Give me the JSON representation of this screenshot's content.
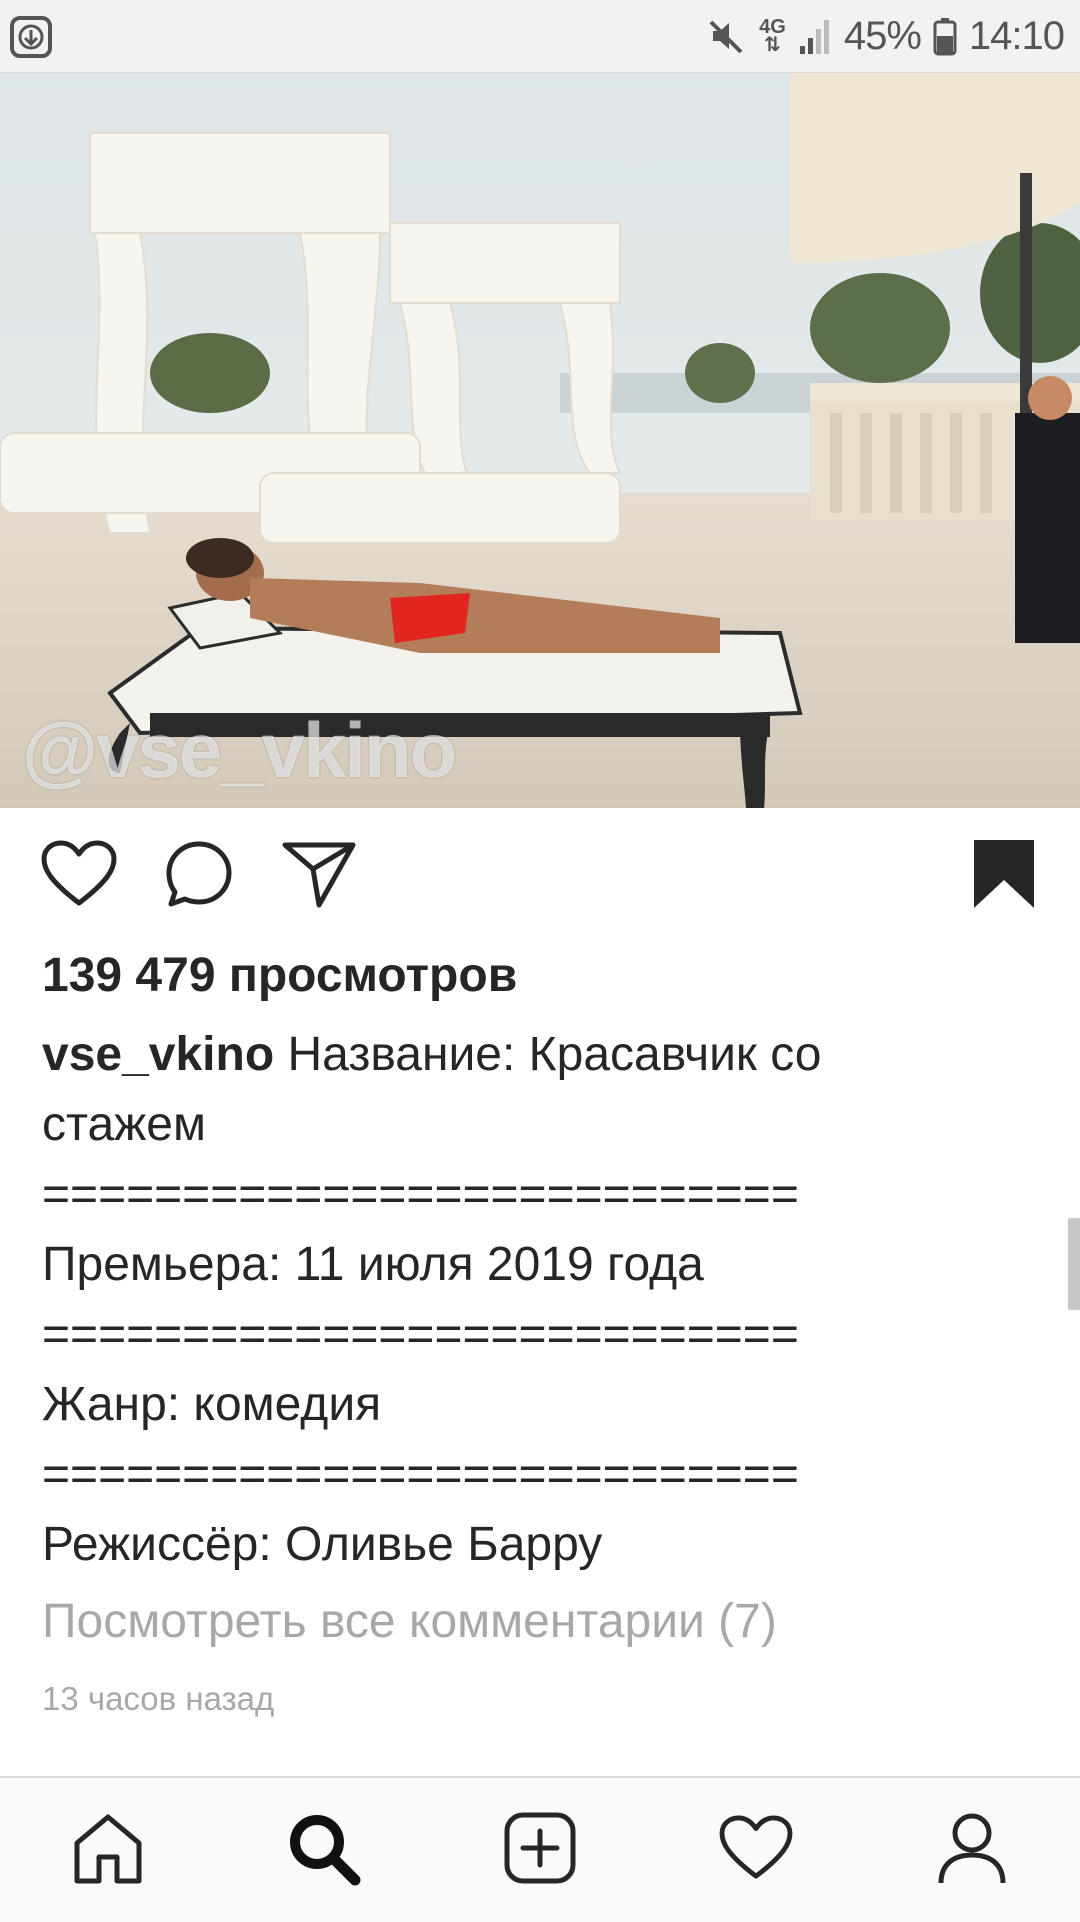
{
  "status_bar": {
    "network": "4G",
    "battery": "45%",
    "time": "14:10"
  },
  "post": {
    "watermark": "@vse_vkino",
    "views": "139 479 просмотров",
    "username": "vse_vkino",
    "caption_first": "Название: Красавчик со",
    "caption_lines": [
      "стажем",
      "===========================",
      "Премьера: 11 июля 2019 года",
      "===========================",
      "Жанр: комедия",
      "===========================",
      "Режиссёр: Оливье Барру"
    ],
    "view_comments": "Посмотреть все комментарии (7)",
    "timestamp": "13 часов назад"
  },
  "icons": {
    "actions": [
      "heart-icon",
      "comment-icon",
      "share-icon",
      "bookmark-icon"
    ],
    "nav": [
      "home-icon",
      "search-icon",
      "add-post-icon",
      "activity-heart-icon",
      "profile-icon"
    ]
  },
  "colors": {
    "text": "#262626",
    "muted": "#a8a8a8",
    "status_bar_bg": "#f2f2f2",
    "nav_bg": "#fafafa"
  }
}
